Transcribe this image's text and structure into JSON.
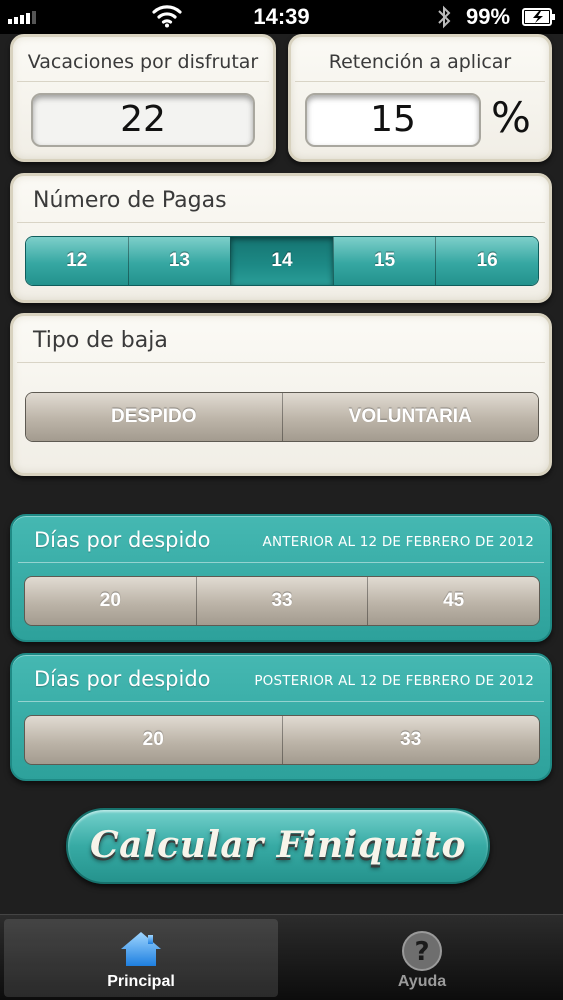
{
  "status_bar": {
    "time": "14:39",
    "battery": "99%",
    "icons": [
      "signal-icon",
      "wifi-icon",
      "bluetooth-icon",
      "battery-icon"
    ]
  },
  "vacaciones": {
    "label": "Vacaciones por disfrutar",
    "value": "22"
  },
  "retencion": {
    "label": "Retención a aplicar",
    "value": "15",
    "unit": "%"
  },
  "pagas": {
    "label": "Número de Pagas",
    "options": [
      "12",
      "13",
      "14",
      "15",
      "16"
    ],
    "selected": "14"
  },
  "tipo_baja": {
    "label": "Tipo de baja",
    "options": [
      "DESPIDO",
      "VOLUNTARIA"
    ]
  },
  "dias_anterior": {
    "title": "Días por despido",
    "subtitle": "ANTERIOR AL 12 DE FEBRERO DE 2012",
    "options": [
      "20",
      "33",
      "45"
    ]
  },
  "dias_posterior": {
    "title": "Días por despido",
    "subtitle": "POSTERIOR AL 12 DE FEBRERO DE 2012",
    "options": [
      "20",
      "33"
    ]
  },
  "calc_button": {
    "label": "Calcular Finiquito"
  },
  "tabbar": {
    "tabs": [
      {
        "label": "Principal",
        "icon": "home-icon",
        "active": true
      },
      {
        "label": "Ayuda",
        "icon": "help-icon",
        "active": false
      }
    ]
  },
  "colors": {
    "teal": "#36a7a2",
    "teal_dark": "#1d8a86",
    "cream": "#f4f1e9",
    "taupe": "#bcb4a8",
    "background": "#1f1f1f"
  }
}
